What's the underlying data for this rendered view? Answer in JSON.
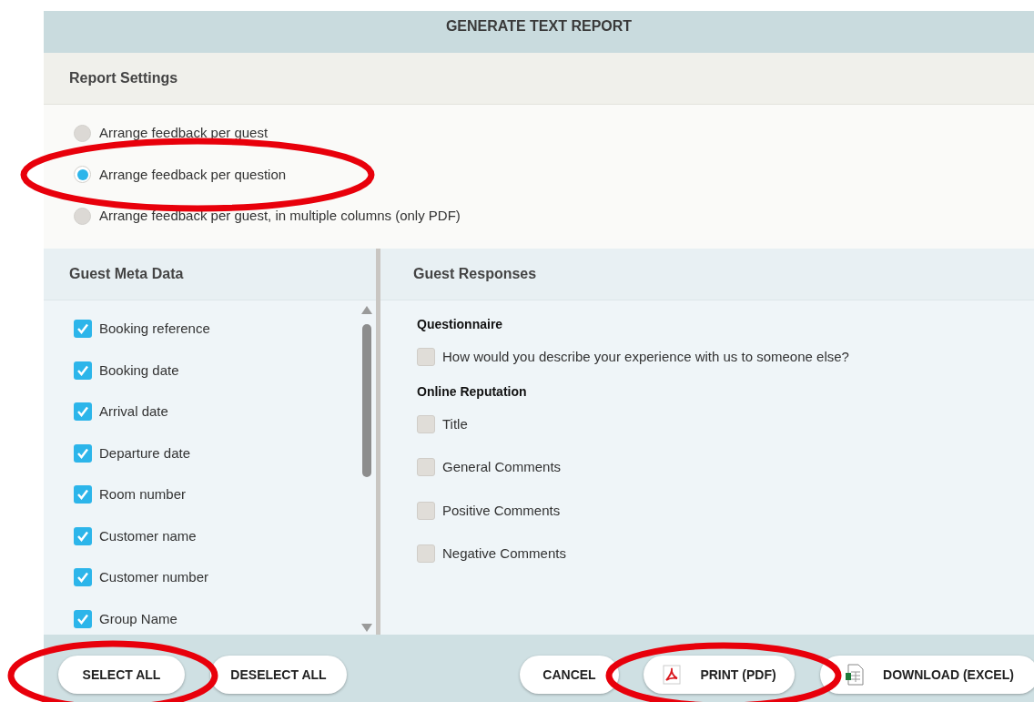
{
  "dialog": {
    "title": "GENERATE TEXT REPORT"
  },
  "report_settings": {
    "heading": "Report Settings",
    "options": [
      {
        "label": "Arrange feedback per guest",
        "selected": false
      },
      {
        "label": "Arrange feedback per question",
        "selected": true
      },
      {
        "label": "Arrange feedback per guest, in multiple columns (only PDF)",
        "selected": false
      }
    ]
  },
  "guest_meta_data": {
    "heading": "Guest Meta Data",
    "items": [
      {
        "label": "Booking reference",
        "checked": true
      },
      {
        "label": "Booking date",
        "checked": true
      },
      {
        "label": "Arrival date",
        "checked": true
      },
      {
        "label": "Departure date",
        "checked": true
      },
      {
        "label": "Room number",
        "checked": true
      },
      {
        "label": "Customer name",
        "checked": true
      },
      {
        "label": "Customer number",
        "checked": true
      },
      {
        "label": "Group Name",
        "checked": true
      }
    ]
  },
  "guest_responses": {
    "heading": "Guest Responses",
    "groups": [
      {
        "title": "Questionnaire",
        "items": [
          {
            "label": "How would you describe your experience with us to someone else?",
            "checked": false
          }
        ]
      },
      {
        "title": "Online Reputation",
        "items": [
          {
            "label": "Title",
            "checked": false
          },
          {
            "label": "General Comments",
            "checked": false
          },
          {
            "label": "Positive Comments",
            "checked": false
          },
          {
            "label": "Negative Comments",
            "checked": false
          }
        ]
      }
    ]
  },
  "footer_buttons": [
    {
      "label": "SELECT ALL",
      "kind": "plain"
    },
    {
      "label": "DESELECT ALL",
      "kind": "plain"
    },
    {
      "label": "CANCEL",
      "kind": "plain"
    },
    {
      "label": "PRINT (PDF)",
      "kind": "pdf"
    },
    {
      "label": "DOWNLOAD (EXCEL)",
      "kind": "sheet"
    }
  ]
}
